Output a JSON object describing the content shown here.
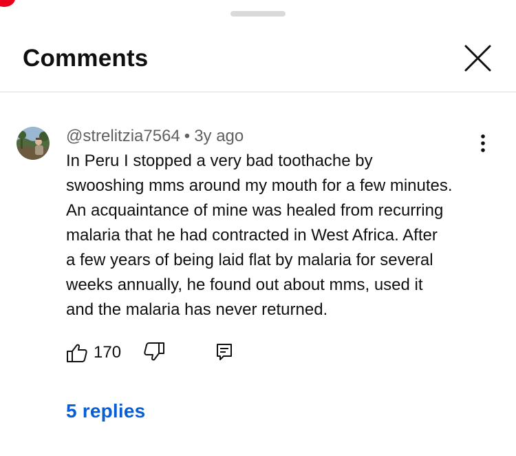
{
  "panel": {
    "title": "Comments"
  },
  "comment": {
    "author": "@strelitzia7564",
    "separator": "•",
    "age": "3y ago",
    "text": "In Peru I stopped a very bad toothache by\nswooshing mms around my mouth for a few minutes.\nAn acquaintance of mine was healed from recurring\nmalaria that he had contracted in West Africa. After\na few years of being laid flat by malaria for several\nweeks annually, he found out about mms, used it\nand the malaria has never returned.",
    "like_count": "170",
    "replies_label": "5 replies"
  },
  "icons": {
    "close": "close-icon",
    "more": "more-vertical-icon",
    "like": "thumbs-up-icon",
    "dislike": "thumbs-down-icon",
    "reply": "reply-icon",
    "avatar": "avatar-image"
  },
  "colors": {
    "link": "#065fd4",
    "meta_text": "#606060",
    "primary_text": "#0f0f0f",
    "divider": "#dcdcdc",
    "handle": "#d9d9d9",
    "status_dot": "#e8001c"
  }
}
